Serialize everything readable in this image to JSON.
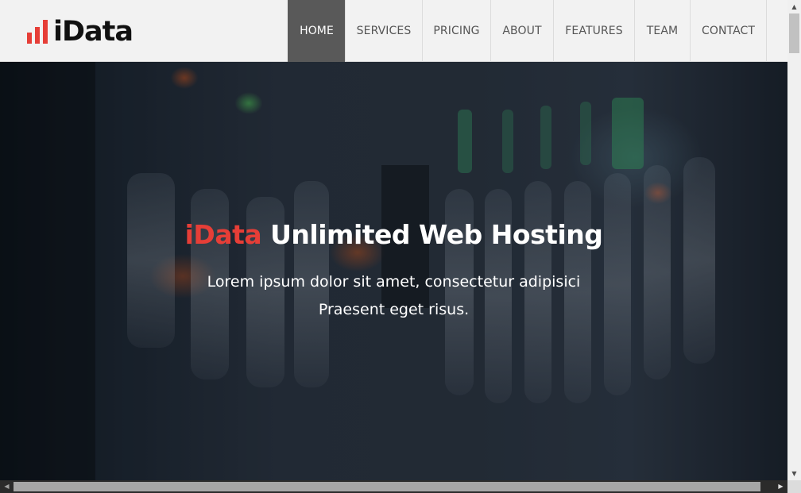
{
  "brand": {
    "name": "iData",
    "icon": "bar-chart-icon",
    "accent_color": "#e63e37"
  },
  "nav": {
    "items": [
      {
        "label": "HOME",
        "active": true
      },
      {
        "label": "SERVICES",
        "active": false
      },
      {
        "label": "PRICING",
        "active": false
      },
      {
        "label": "ABOUT",
        "active": false
      },
      {
        "label": "FEATURES",
        "active": false
      },
      {
        "label": "TEAM",
        "active": false
      },
      {
        "label": "CONTACT",
        "active": false
      }
    ]
  },
  "hero": {
    "title_accent": "iData",
    "title_rest": "Unlimited Web Hosting",
    "subtitle_line1": "Lorem ipsum dolor sit amet, consectetur adipisici",
    "subtitle_line2": "Praesent eget risus."
  },
  "scrollbars": {
    "up_arrow": "▲",
    "down_arrow": "▼",
    "left_arrow": "◀",
    "right_arrow": "▶"
  }
}
